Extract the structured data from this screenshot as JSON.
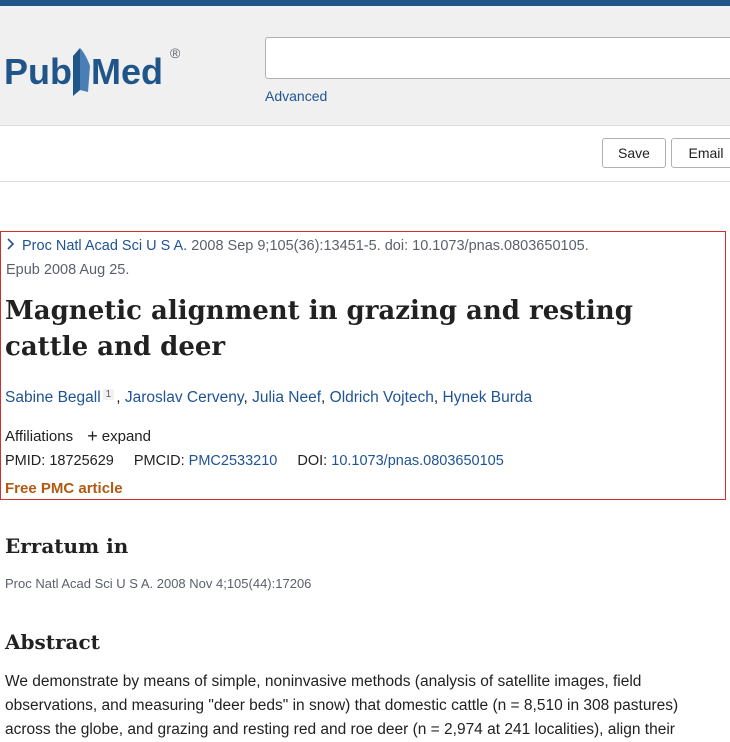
{
  "header": {
    "logo_text": "PubMed",
    "search_value": "",
    "advanced_label": "Advanced"
  },
  "actions": {
    "save_label": "Save",
    "email_label": "Email"
  },
  "article": {
    "journal": "Proc Natl Acad Sci U S A.",
    "citation_rest": "2008 Sep 9;105(36):13451-5. doi: 10.1073/pnas.0803650105.",
    "epub": "Epub 2008 Aug 25.",
    "title": "Magnetic alignment in grazing and resting cattle and deer",
    "authors": [
      {
        "name": "Sabine Begall",
        "sup": "1"
      },
      {
        "name": "Jaroslav Cerveny"
      },
      {
        "name": "Julia Neef"
      },
      {
        "name": "Oldrich Vojtech"
      },
      {
        "name": "Hynek Burda"
      }
    ],
    "affiliations_label": "Affiliations",
    "expand_label": "expand",
    "pmid_label": "PMID:",
    "pmid": "18725629",
    "pmcid_label": "PMCID:",
    "pmcid": "PMC2533210",
    "doi_label": "DOI:",
    "doi": "10.1073/pnas.0803650105",
    "free_pmc": "Free PMC article"
  },
  "erratum": {
    "heading": "Erratum in",
    "text": "Proc Natl Acad Sci U S A. 2008 Nov 4;105(44):17206"
  },
  "abstract": {
    "heading": "Abstract",
    "text": "We demonstrate by means of simple, noninvasive methods (analysis of satellite images, field observations, and measuring \"deer beds\" in snow) that domestic cattle (n = 8,510 in 308 pastures) across the globe, and grazing and resting red and roe deer (n = 2,974 at 241 localities), align their"
  },
  "colors": {
    "brand_blue": "#20558a",
    "link_blue": "#205493",
    "free_pmc_orange": "#b05a12",
    "highlight_box": "#d32f2f"
  },
  "icons": {
    "logo": "pubmed-logo",
    "citation_chevron": "chevron-right-icon",
    "expand": "plus-icon"
  }
}
